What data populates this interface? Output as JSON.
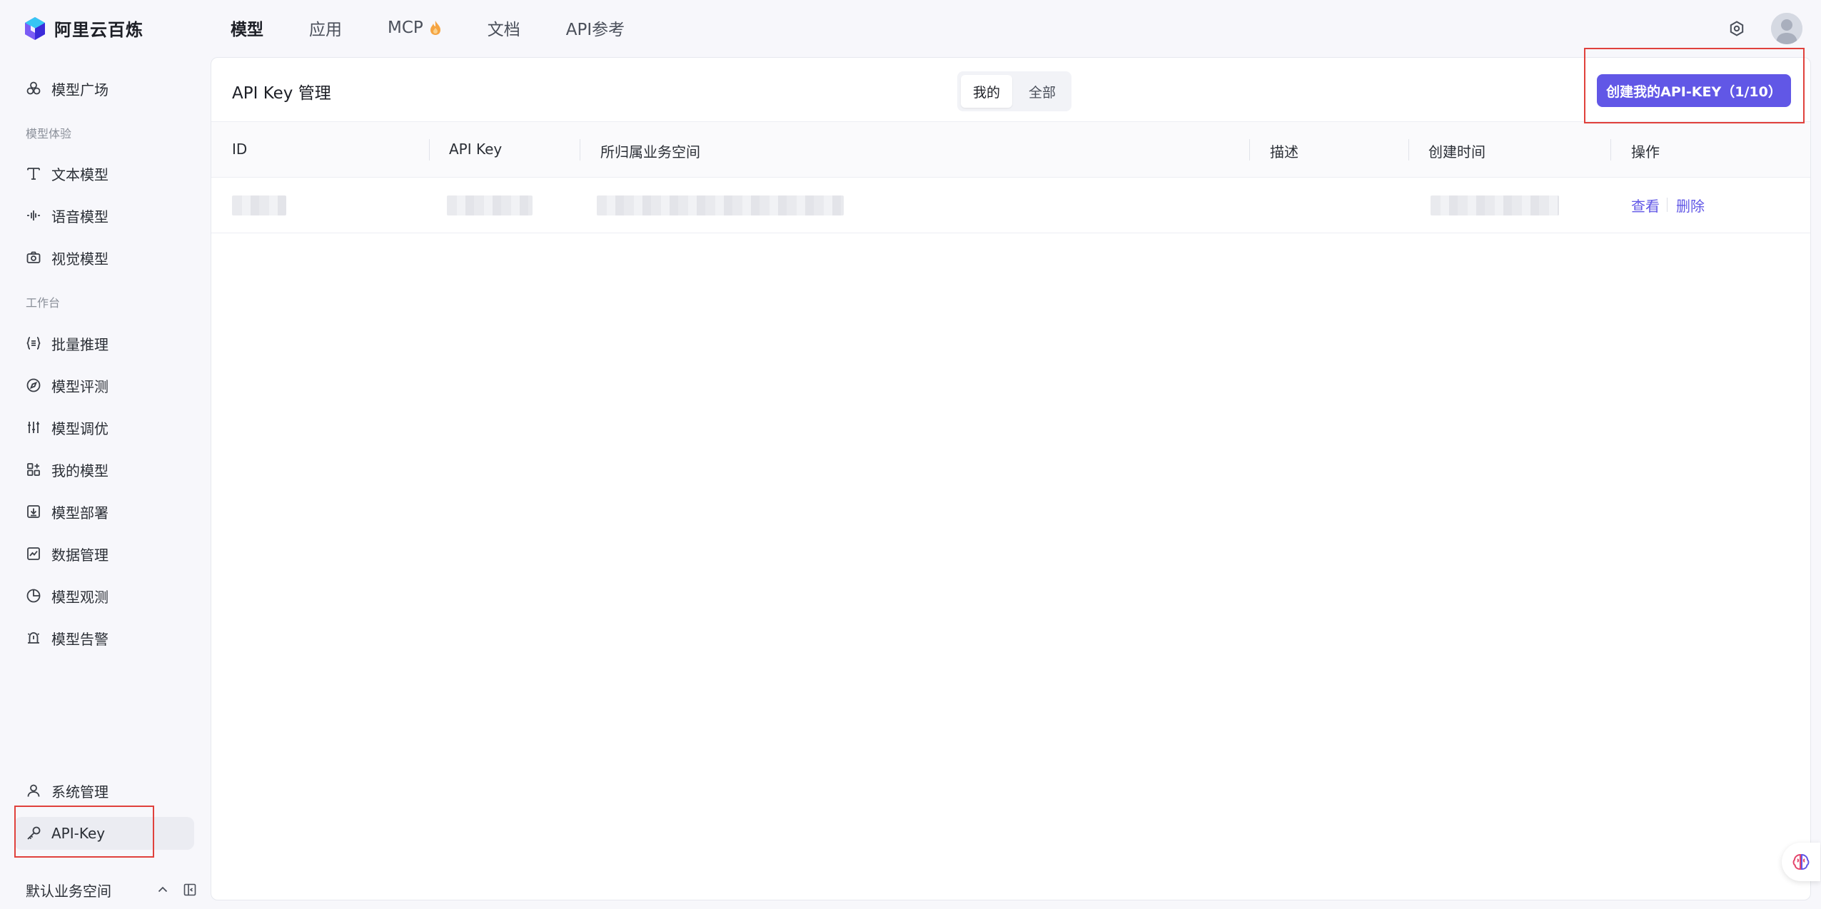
{
  "brand": {
    "name": "阿里云百炼"
  },
  "nav": {
    "items": [
      {
        "label": "模型",
        "active": true
      },
      {
        "label": "应用"
      },
      {
        "label": "MCP",
        "badge_icon": "flame-icon"
      },
      {
        "label": "文档"
      },
      {
        "label": "API参考"
      }
    ]
  },
  "sidebar": {
    "model_square": "模型广场",
    "group_experience": "模型体验",
    "text_model": "文本模型",
    "voice_model": "语音模型",
    "vision_model": "视觉模型",
    "group_workbench": "工作台",
    "batch_inference": "批量推理",
    "model_eval": "模型评测",
    "model_tuning": "模型调优",
    "my_models": "我的模型",
    "model_deploy": "模型部署",
    "data_manage": "数据管理",
    "model_observe": "模型观测",
    "model_alert": "模型告警",
    "system_manage": "系统管理",
    "api_key": "API-Key",
    "workspace": "默认业务空间"
  },
  "panel": {
    "title": "API Key 管理",
    "segments": {
      "mine": "我的",
      "all": "全部"
    },
    "create_button": "创建我的API-KEY（1/10）"
  },
  "table": {
    "columns": {
      "id": "ID",
      "api_key": "API Key",
      "workspace": "所归属业务空间",
      "desc": "描述",
      "created": "创建时间",
      "actions": "操作"
    },
    "row_actions": {
      "view": "查看",
      "delete": "删除"
    }
  },
  "colors": {
    "accent": "#6157e6",
    "annotation": "#e0413c"
  }
}
